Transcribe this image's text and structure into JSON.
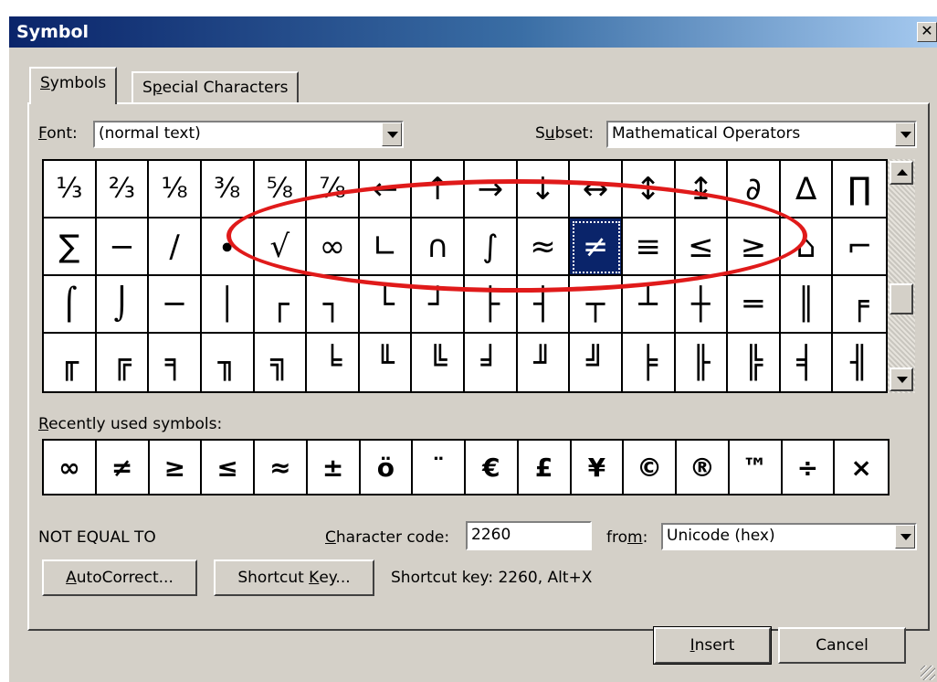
{
  "window": {
    "title": "Symbol",
    "close": "✕"
  },
  "tabs": [
    {
      "label_u": "S",
      "label_rest": "ymbols",
      "active": true
    },
    {
      "label_pre": "S",
      "label_u": "p",
      "label_rest": "ecial Characters",
      "active": false
    }
  ],
  "font": {
    "label_u": "F",
    "label_rest": "ont:",
    "value": "(normal text)"
  },
  "subset": {
    "label_pre": "S",
    "label_u": "u",
    "label_rest": "bset:",
    "value": "Mathematical Operators"
  },
  "symbol_grid": {
    "rows": [
      [
        "⅓",
        "⅔",
        "⅛",
        "⅜",
        "⅝",
        "⅞",
        "←",
        "↑",
        "→",
        "↓",
        "↔",
        "↕",
        "↨",
        "∂",
        "∆",
        "∏"
      ],
      [
        "∑",
        "−",
        "∕",
        "∙",
        "√",
        "∞",
        "∟",
        "∩",
        "∫",
        "≈",
        "≠",
        "≡",
        "≤",
        "≥",
        "⌂",
        "⌐"
      ],
      [
        "⌠",
        "⌡",
        "─",
        "│",
        "┌",
        "┐",
        "└",
        "┘",
        "├",
        "┤",
        "┬",
        "┴",
        "┼",
        "═",
        "║",
        "╒"
      ],
      [
        "╓",
        "╔",
        "╕",
        "╖",
        "╗",
        "╘",
        "╙",
        "╚",
        "╛",
        "╜",
        "╝",
        "╞",
        "╟",
        "╠",
        "╡",
        "╢"
      ]
    ],
    "selected": "≠"
  },
  "recent": {
    "label_u": "R",
    "label_rest": "ecently used symbols:",
    "symbols": [
      "∞",
      "≠",
      "≥",
      "≤",
      "≈",
      "±",
      "ö",
      "¨",
      "€",
      "£",
      "¥",
      "©",
      "®",
      "™",
      "÷",
      "×"
    ]
  },
  "char_name": "NOT EQUAL TO",
  "char_code": {
    "label_pre": "",
    "label_u": "C",
    "label_rest": "haracter code:",
    "value": "2260"
  },
  "from": {
    "label_pre": "fro",
    "label_u": "m",
    "label_rest": ":",
    "value": "Unicode (hex)"
  },
  "buttons": {
    "autocorrect_u": "A",
    "autocorrect_rest": "utoCorrect...",
    "shortcut_pre": "Shortcut ",
    "shortcut_u": "K",
    "shortcut_rest": "ey...",
    "insert_u": "I",
    "insert_rest": "nsert",
    "cancel": "Cancel"
  },
  "shortcut_text": "Shortcut key: 2260, Alt+X",
  "annotation_color": "#e01a1a",
  "selection_color": "#0a246a"
}
